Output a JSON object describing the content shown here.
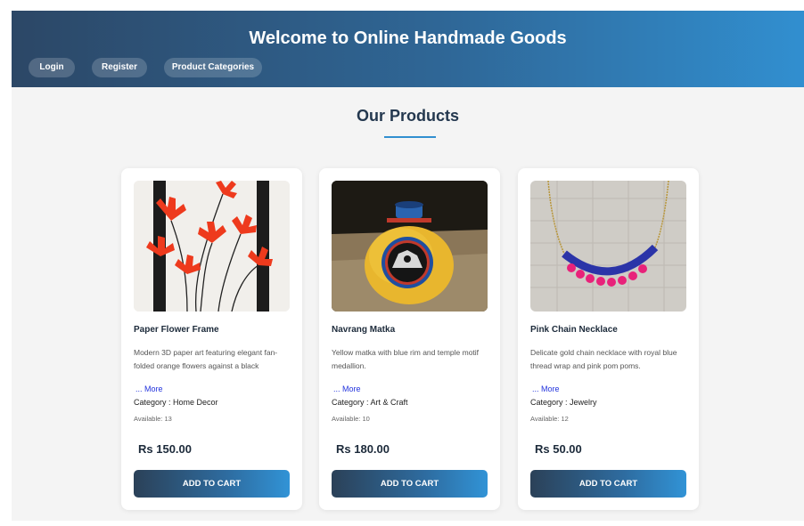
{
  "header": {
    "title": "Welcome to Online Handmade Goods",
    "nav": [
      "Login",
      "Register",
      "Product Categories"
    ]
  },
  "section": {
    "title": "Our Products"
  },
  "products": [
    {
      "name": "Paper Flower Frame",
      "description": "Modern 3D paper art featuring elegant fan-folded orange flowers against a black",
      "more": "... More",
      "category": "Category : Home Decor",
      "available": "Available: 13",
      "price": "Rs 150.00",
      "button": "ADD TO CART"
    },
    {
      "name": "Navrang Matka",
      "description": "Yellow matka with blue rim and temple motif medallion.",
      "more": "... More",
      "category": "Category : Art & Craft",
      "available": "Available: 10",
      "price": "Rs 180.00",
      "button": "ADD TO CART"
    },
    {
      "name": "Pink Chain Necklace",
      "description": "Delicate gold chain necklace with royal blue thread wrap and pink pom poms.",
      "more": "... More",
      "category": "Category : Jewelry",
      "available": "Available: 12",
      "price": "Rs 50.00",
      "button": "ADD TO CART"
    }
  ],
  "colors": {
    "header_start": "#2c4766",
    "header_end": "#318fd0",
    "title_text": "#24384f",
    "more_link": "#2233dd"
  }
}
